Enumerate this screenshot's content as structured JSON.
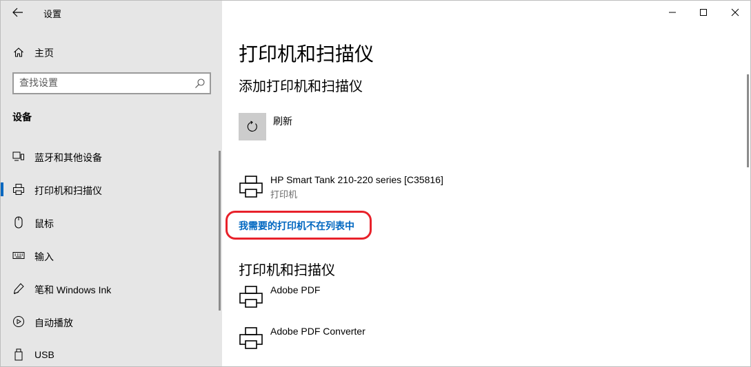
{
  "window": {
    "title": "设置"
  },
  "sidebar": {
    "home_label": "主页",
    "search_placeholder": "查找设置",
    "section_title": "设备",
    "items": [
      {
        "label": "蓝牙和其他设备",
        "icon": "bluetooth-devices-icon",
        "active": false
      },
      {
        "label": "打印机和扫描仪",
        "icon": "printer-icon",
        "active": true
      },
      {
        "label": "鼠标",
        "icon": "mouse-icon",
        "active": false
      },
      {
        "label": "输入",
        "icon": "keyboard-icon",
        "active": false
      },
      {
        "label": "笔和 Windows Ink",
        "icon": "pen-icon",
        "active": false
      },
      {
        "label": "自动播放",
        "icon": "autoplay-icon",
        "active": false
      },
      {
        "label": "USB",
        "icon": "usb-icon",
        "active": false
      }
    ]
  },
  "main": {
    "page_title": "打印机和扫描仪",
    "add_section_title": "添加打印机和扫描仪",
    "refresh_label": "刷新",
    "found_device": {
      "name": "HP Smart Tank 210-220 series [C35816]",
      "type": "打印机"
    },
    "not_listed_link": "我需要的打印机不在列表中",
    "list_section_title": "打印机和扫描仪",
    "printers": [
      {
        "name": "Adobe PDF"
      },
      {
        "name": "Adobe PDF Converter"
      }
    ]
  },
  "colors": {
    "accent": "#0067c0",
    "sidebar_bg": "#e6e6e6",
    "highlight": "#e8212a"
  }
}
